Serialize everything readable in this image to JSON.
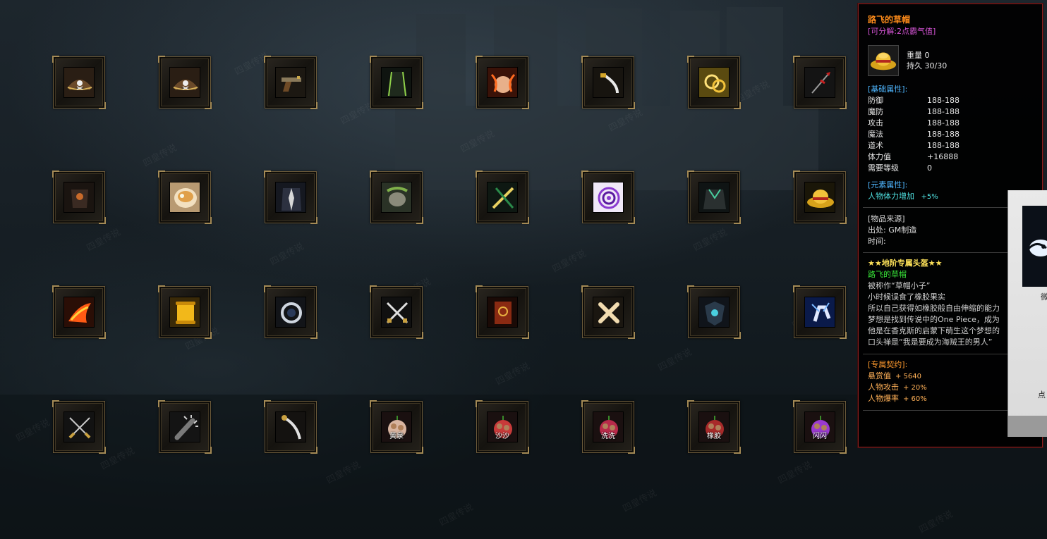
{
  "grid": {
    "rows": [
      [
        {
          "name": "pirate-hat-icon"
        },
        {
          "name": "pirate-hat-icon"
        },
        {
          "name": "flintlock-pistol-icon"
        },
        {
          "name": "green-cloak-icon"
        },
        {
          "name": "fire-fist-icon"
        },
        {
          "name": "golden-saber-icon"
        },
        {
          "name": "golden-swirl-icon"
        },
        {
          "name": "red-spear-icon"
        }
      ],
      [
        {
          "name": "dark-armor-icon"
        },
        {
          "name": "noodle-bowl-icon"
        },
        {
          "name": "black-suit-icon"
        },
        {
          "name": "green-fist-icon"
        },
        {
          "name": "twin-blades-icon"
        },
        {
          "name": "purple-spiral-icon"
        },
        {
          "name": "dark-cape-icon"
        },
        {
          "name": "straw-hat-icon"
        }
      ],
      [
        {
          "name": "flame-kick-icon"
        },
        {
          "name": "golden-scroll-icon"
        },
        {
          "name": "lens-scope-icon"
        },
        {
          "name": "crossed-swords-icon"
        },
        {
          "name": "red-book-icon"
        },
        {
          "name": "crossed-bones-icon"
        },
        {
          "name": "dark-shield-icon"
        },
        {
          "name": "lightning-hand-icon"
        }
      ],
      [
        {
          "name": "crossed-katanas-icon"
        },
        {
          "name": "spiked-club-icon"
        },
        {
          "name": "curved-saber-icon"
        },
        {
          "name": "devil-fruit-icon",
          "label": "黄泉"
        },
        {
          "name": "devil-fruit-icon",
          "label": "沙沙"
        },
        {
          "name": "devil-fruit-icon",
          "label": "洗洗"
        },
        {
          "name": "devil-fruit-icon",
          "label": "橡胶"
        },
        {
          "name": "devil-fruit-icon",
          "label": "闪闪"
        }
      ]
    ]
  },
  "tooltip": {
    "title": "路飞的草帽",
    "decompose": "[可分解:2点霸气值]",
    "icon": "straw-hat-icon",
    "weight": "重量 0",
    "durability": "持久 30/30",
    "base_header": "[基础属性]:",
    "base_stats": [
      {
        "k": "防御",
        "v": "188-188"
      },
      {
        "k": "魔防",
        "v": "188-188"
      },
      {
        "k": "攻击",
        "v": "188-188"
      },
      {
        "k": "魔法",
        "v": "188-188"
      },
      {
        "k": "道术",
        "v": "188-188"
      },
      {
        "k": "体力值",
        "v": "+16888"
      },
      {
        "k": "需要等级",
        "v": "0"
      }
    ],
    "element_header": "[元素属性]:",
    "element_stat_k": "人物体力增加",
    "element_stat_v": "+5%",
    "source_header": "[物品来源]",
    "source_from": "出处: GM制造",
    "source_time": "时间:",
    "exclusive": "★★地阶专属头盔★★",
    "item_name": "路飞的草帽",
    "desc": [
      "被称作“草帽小子”",
      "小时候误食了橡胶果实",
      "所以自己获得如橡胶般自由伸缩的能力",
      "梦想是找到传说中的One Piece，成为",
      "他是在香克斯的启蒙下萌生这个梦想的",
      "口头禅是“我是要成为海贼王的男人”"
    ],
    "contract_header": "[专属契约]:",
    "contract": [
      {
        "k": "悬赏值",
        "v": "+ 5640"
      },
      {
        "k": "人物攻击",
        "v": "+ 20%"
      },
      {
        "k": "人物爆率",
        "v": "+ 60%"
      }
    ]
  },
  "side_panel": {
    "t1": "微",
    "t2": "点"
  },
  "watermark": "四皇传说"
}
